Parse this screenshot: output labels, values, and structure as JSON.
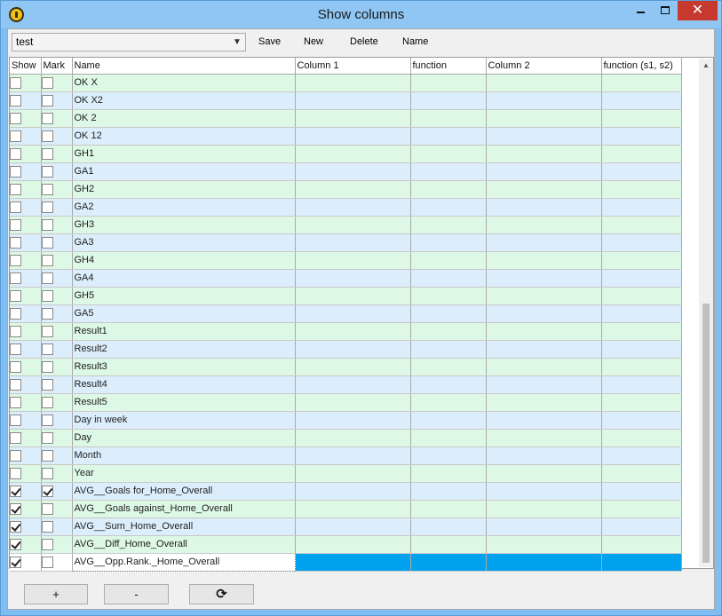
{
  "window": {
    "title": "Show columns",
    "close_glyph": "✕"
  },
  "toolbar": {
    "combo_value": "test",
    "save_label": "Save",
    "new_label": "New",
    "delete_label": "Delete",
    "name_label": "Name"
  },
  "grid": {
    "headers": [
      "Show",
      "Mark",
      "Name",
      "Column 1",
      "function",
      "Column 2",
      "function (s1, s2)"
    ],
    "rows": [
      {
        "name": "OK X",
        "show": false,
        "mark": false,
        "tint": "green"
      },
      {
        "name": "OK X2",
        "show": false,
        "mark": false,
        "tint": "blue"
      },
      {
        "name": "OK 2",
        "show": false,
        "mark": false,
        "tint": "green"
      },
      {
        "name": "OK 12",
        "show": false,
        "mark": false,
        "tint": "blue"
      },
      {
        "name": "GH1",
        "show": false,
        "mark": false,
        "tint": "green"
      },
      {
        "name": "GA1",
        "show": false,
        "mark": false,
        "tint": "blue"
      },
      {
        "name": "GH2",
        "show": false,
        "mark": false,
        "tint": "green"
      },
      {
        "name": "GA2",
        "show": false,
        "mark": false,
        "tint": "blue"
      },
      {
        "name": "GH3",
        "show": false,
        "mark": false,
        "tint": "green"
      },
      {
        "name": "GA3",
        "show": false,
        "mark": false,
        "tint": "blue"
      },
      {
        "name": "GH4",
        "show": false,
        "mark": false,
        "tint": "green"
      },
      {
        "name": "GA4",
        "show": false,
        "mark": false,
        "tint": "blue"
      },
      {
        "name": "GH5",
        "show": false,
        "mark": false,
        "tint": "green"
      },
      {
        "name": "GA5",
        "show": false,
        "mark": false,
        "tint": "blue"
      },
      {
        "name": "Result1",
        "show": false,
        "mark": false,
        "tint": "green"
      },
      {
        "name": "Result2",
        "show": false,
        "mark": false,
        "tint": "blue"
      },
      {
        "name": "Result3",
        "show": false,
        "mark": false,
        "tint": "green"
      },
      {
        "name": "Result4",
        "show": false,
        "mark": false,
        "tint": "blue"
      },
      {
        "name": "Result5",
        "show": false,
        "mark": false,
        "tint": "green"
      },
      {
        "name": "Day in week",
        "show": false,
        "mark": false,
        "tint": "blue"
      },
      {
        "name": "Day",
        "show": false,
        "mark": false,
        "tint": "green"
      },
      {
        "name": "Month",
        "show": false,
        "mark": false,
        "tint": "blue"
      },
      {
        "name": "Year",
        "show": false,
        "mark": false,
        "tint": "green"
      },
      {
        "name": "AVG__Goals for_Home_Overall",
        "show": true,
        "mark": true,
        "tint": "blue"
      },
      {
        "name": "AVG__Goals against_Home_Overall",
        "show": true,
        "mark": false,
        "tint": "green"
      },
      {
        "name": "AVG__Sum_Home_Overall",
        "show": true,
        "mark": false,
        "tint": "blue"
      },
      {
        "name": "AVG__Diff_Home_Overall",
        "show": true,
        "mark": false,
        "tint": "green"
      },
      {
        "name": "AVG__Opp.Rank._Home_Overall",
        "show": true,
        "mark": false,
        "tint": "selected"
      }
    ]
  },
  "bottom": {
    "add_label": "+",
    "remove_label": "-",
    "refresh_icon": "refresh-icon",
    "refresh_glyph": "⟳"
  },
  "colors": {
    "row_green": "#ddf8e4",
    "row_blue": "#dceefc",
    "selection": "#00a2ed",
    "close_red": "#c7392f"
  }
}
